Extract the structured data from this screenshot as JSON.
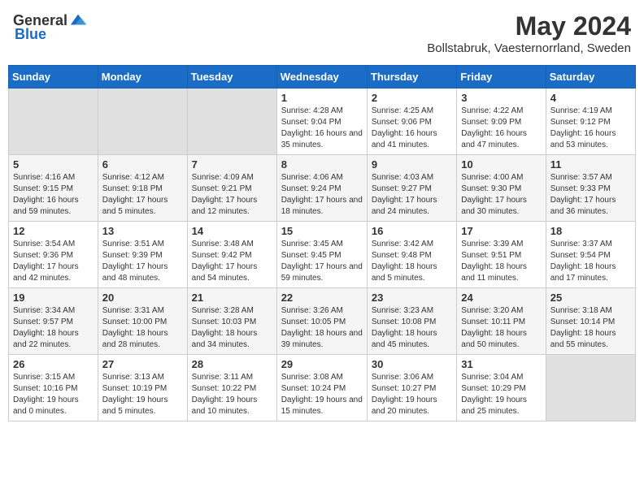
{
  "header": {
    "logo_general": "General",
    "logo_blue": "Blue",
    "month_year": "May 2024",
    "location": "Bollstabruk, Vaesternorrland, Sweden"
  },
  "days_of_week": [
    "Sunday",
    "Monday",
    "Tuesday",
    "Wednesday",
    "Thursday",
    "Friday",
    "Saturday"
  ],
  "weeks": [
    {
      "days": [
        {
          "num": "",
          "info": ""
        },
        {
          "num": "",
          "info": ""
        },
        {
          "num": "",
          "info": ""
        },
        {
          "num": "1",
          "info": "Sunrise: 4:28 AM\nSunset: 9:04 PM\nDaylight: 16 hours and 35 minutes."
        },
        {
          "num": "2",
          "info": "Sunrise: 4:25 AM\nSunset: 9:06 PM\nDaylight: 16 hours and 41 minutes."
        },
        {
          "num": "3",
          "info": "Sunrise: 4:22 AM\nSunset: 9:09 PM\nDaylight: 16 hours and 47 minutes."
        },
        {
          "num": "4",
          "info": "Sunrise: 4:19 AM\nSunset: 9:12 PM\nDaylight: 16 hours and 53 minutes."
        }
      ]
    },
    {
      "days": [
        {
          "num": "5",
          "info": "Sunrise: 4:16 AM\nSunset: 9:15 PM\nDaylight: 16 hours and 59 minutes."
        },
        {
          "num": "6",
          "info": "Sunrise: 4:12 AM\nSunset: 9:18 PM\nDaylight: 17 hours and 5 minutes."
        },
        {
          "num": "7",
          "info": "Sunrise: 4:09 AM\nSunset: 9:21 PM\nDaylight: 17 hours and 12 minutes."
        },
        {
          "num": "8",
          "info": "Sunrise: 4:06 AM\nSunset: 9:24 PM\nDaylight: 17 hours and 18 minutes."
        },
        {
          "num": "9",
          "info": "Sunrise: 4:03 AM\nSunset: 9:27 PM\nDaylight: 17 hours and 24 minutes."
        },
        {
          "num": "10",
          "info": "Sunrise: 4:00 AM\nSunset: 9:30 PM\nDaylight: 17 hours and 30 minutes."
        },
        {
          "num": "11",
          "info": "Sunrise: 3:57 AM\nSunset: 9:33 PM\nDaylight: 17 hours and 36 minutes."
        }
      ]
    },
    {
      "days": [
        {
          "num": "12",
          "info": "Sunrise: 3:54 AM\nSunset: 9:36 PM\nDaylight: 17 hours and 42 minutes."
        },
        {
          "num": "13",
          "info": "Sunrise: 3:51 AM\nSunset: 9:39 PM\nDaylight: 17 hours and 48 minutes."
        },
        {
          "num": "14",
          "info": "Sunrise: 3:48 AM\nSunset: 9:42 PM\nDaylight: 17 hours and 54 minutes."
        },
        {
          "num": "15",
          "info": "Sunrise: 3:45 AM\nSunset: 9:45 PM\nDaylight: 17 hours and 59 minutes."
        },
        {
          "num": "16",
          "info": "Sunrise: 3:42 AM\nSunset: 9:48 PM\nDaylight: 18 hours and 5 minutes."
        },
        {
          "num": "17",
          "info": "Sunrise: 3:39 AM\nSunset: 9:51 PM\nDaylight: 18 hours and 11 minutes."
        },
        {
          "num": "18",
          "info": "Sunrise: 3:37 AM\nSunset: 9:54 PM\nDaylight: 18 hours and 17 minutes."
        }
      ]
    },
    {
      "days": [
        {
          "num": "19",
          "info": "Sunrise: 3:34 AM\nSunset: 9:57 PM\nDaylight: 18 hours and 22 minutes."
        },
        {
          "num": "20",
          "info": "Sunrise: 3:31 AM\nSunset: 10:00 PM\nDaylight: 18 hours and 28 minutes."
        },
        {
          "num": "21",
          "info": "Sunrise: 3:28 AM\nSunset: 10:03 PM\nDaylight: 18 hours and 34 minutes."
        },
        {
          "num": "22",
          "info": "Sunrise: 3:26 AM\nSunset: 10:05 PM\nDaylight: 18 hours and 39 minutes."
        },
        {
          "num": "23",
          "info": "Sunrise: 3:23 AM\nSunset: 10:08 PM\nDaylight: 18 hours and 45 minutes."
        },
        {
          "num": "24",
          "info": "Sunrise: 3:20 AM\nSunset: 10:11 PM\nDaylight: 18 hours and 50 minutes."
        },
        {
          "num": "25",
          "info": "Sunrise: 3:18 AM\nSunset: 10:14 PM\nDaylight: 18 hours and 55 minutes."
        }
      ]
    },
    {
      "days": [
        {
          "num": "26",
          "info": "Sunrise: 3:15 AM\nSunset: 10:16 PM\nDaylight: 19 hours and 0 minutes."
        },
        {
          "num": "27",
          "info": "Sunrise: 3:13 AM\nSunset: 10:19 PM\nDaylight: 19 hours and 5 minutes."
        },
        {
          "num": "28",
          "info": "Sunrise: 3:11 AM\nSunset: 10:22 PM\nDaylight: 19 hours and 10 minutes."
        },
        {
          "num": "29",
          "info": "Sunrise: 3:08 AM\nSunset: 10:24 PM\nDaylight: 19 hours and 15 minutes."
        },
        {
          "num": "30",
          "info": "Sunrise: 3:06 AM\nSunset: 10:27 PM\nDaylight: 19 hours and 20 minutes."
        },
        {
          "num": "31",
          "info": "Sunrise: 3:04 AM\nSunset: 10:29 PM\nDaylight: 19 hours and 25 minutes."
        },
        {
          "num": "",
          "info": ""
        }
      ]
    }
  ]
}
